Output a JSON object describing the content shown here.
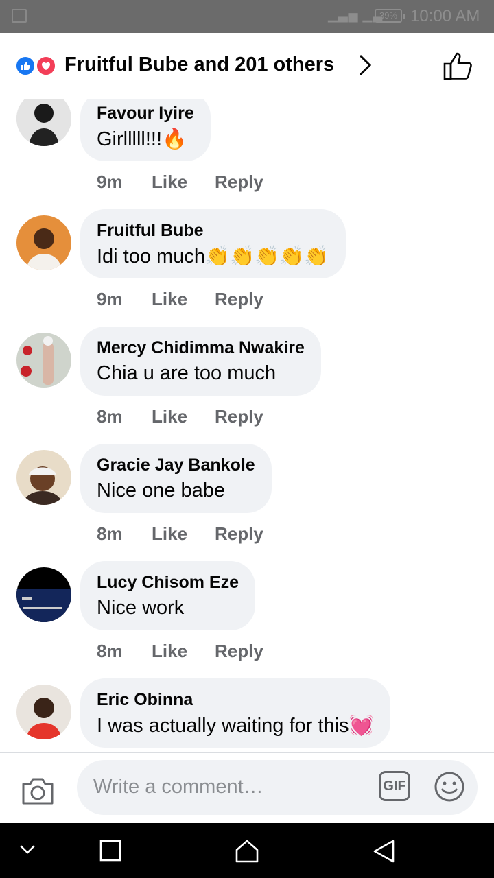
{
  "status_bar": {
    "battery": "39%",
    "time": "10:00 AM"
  },
  "header": {
    "title": "Fruitful Bube and 201 others",
    "reactions": [
      "like-icon",
      "love-icon"
    ]
  },
  "comments": [
    {
      "author": "Favour Iyire",
      "text": "Girlllll!!!🔥",
      "time": "9m",
      "like": "Like",
      "reply": "Reply",
      "avatar_color": "#d9d9d9"
    },
    {
      "author": "Fruitful Bube",
      "text": "Idi too much👏👏👏👏👏",
      "time": "9m",
      "like": "Like",
      "reply": "Reply",
      "avatar_color": "#e58f3b"
    },
    {
      "author": "Mercy Chidimma Nwakire",
      "text": "Chia u are too much",
      "time": "8m",
      "like": "Like",
      "reply": "Reply",
      "avatar_color": "#c9c2bb"
    },
    {
      "author": "Gracie Jay Bankole",
      "text": "Nice one babe",
      "time": "8m",
      "like": "Like",
      "reply": "Reply",
      "avatar_color": "#caa27c"
    },
    {
      "author": "Lucy Chisom Eze",
      "text": "Nice work",
      "time": "8m",
      "like": "Like",
      "reply": "Reply",
      "avatar_color": "#0b1633"
    },
    {
      "author": "Eric Obinna",
      "text": "I was actually waiting for this💓",
      "time": "",
      "like": "",
      "reply": "",
      "avatar_color": "#d8cfc6"
    }
  ],
  "composer": {
    "placeholder": "Write a comment…",
    "gif_label": "GIF"
  },
  "colors": {
    "like_blue": "#1877f2",
    "love_red": "#f33e58",
    "bubble_bg": "#f0f2f5",
    "meta_gray": "#65676b"
  }
}
